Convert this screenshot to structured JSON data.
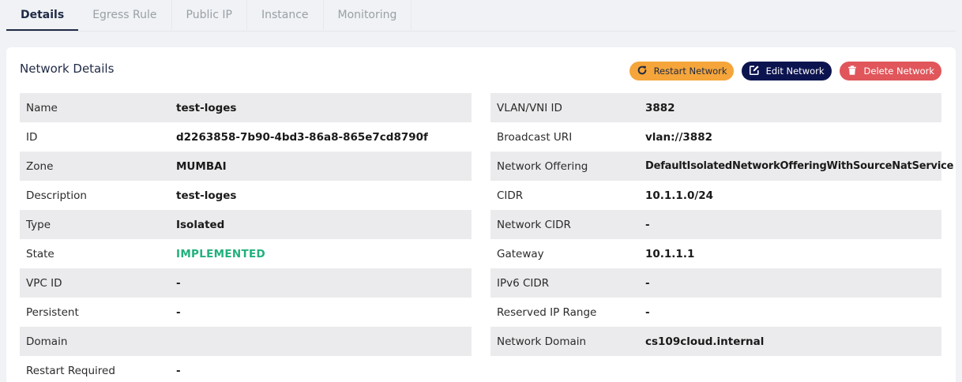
{
  "tabs": [
    {
      "label": "Details",
      "active": true
    },
    {
      "label": "Egress Rule",
      "active": false
    },
    {
      "label": "Public IP",
      "active": false
    },
    {
      "label": "Instance",
      "active": false
    },
    {
      "label": "Monitoring",
      "active": false
    }
  ],
  "card": {
    "title": "Network Details",
    "actions": {
      "restart_label": "Restart Network",
      "edit_label": "Edit Network",
      "delete_label": "Delete Network"
    }
  },
  "colors": {
    "restart": "#f5a53a",
    "edit": "#0c1450",
    "delete": "#e0565b",
    "state_implemented": "#22b07d"
  },
  "details_left": [
    {
      "label": "Name",
      "value": "test-loges"
    },
    {
      "label": "ID",
      "value": "d2263858-7b90-4bd3-86a8-865e7cd8790f"
    },
    {
      "label": "Zone",
      "value": "MUMBAI"
    },
    {
      "label": "Description",
      "value": "test-loges"
    },
    {
      "label": "Type",
      "value": "Isolated"
    },
    {
      "label": "State",
      "value": "IMPLEMENTED"
    },
    {
      "label": "VPC ID",
      "value": "-"
    },
    {
      "label": "Persistent",
      "value": "-"
    },
    {
      "label": "Domain",
      "value": ""
    },
    {
      "label": "Restart Required",
      "value": "-"
    }
  ],
  "details_right": [
    {
      "label": "VLAN/VNI ID",
      "value": "3882"
    },
    {
      "label": "Broadcast URI",
      "value": "vlan://3882"
    },
    {
      "label": "Network Offering",
      "value": "DefaultIsolatedNetworkOfferingWithSourceNatService"
    },
    {
      "label": "CIDR",
      "value": "10.1.1.0/24"
    },
    {
      "label": "Network CIDR",
      "value": "-"
    },
    {
      "label": "Gateway",
      "value": "10.1.1.1"
    },
    {
      "label": "IPv6 CIDR",
      "value": "-"
    },
    {
      "label": "Reserved IP Range",
      "value": "-"
    },
    {
      "label": "Network Domain",
      "value": "cs109cloud.internal"
    }
  ]
}
